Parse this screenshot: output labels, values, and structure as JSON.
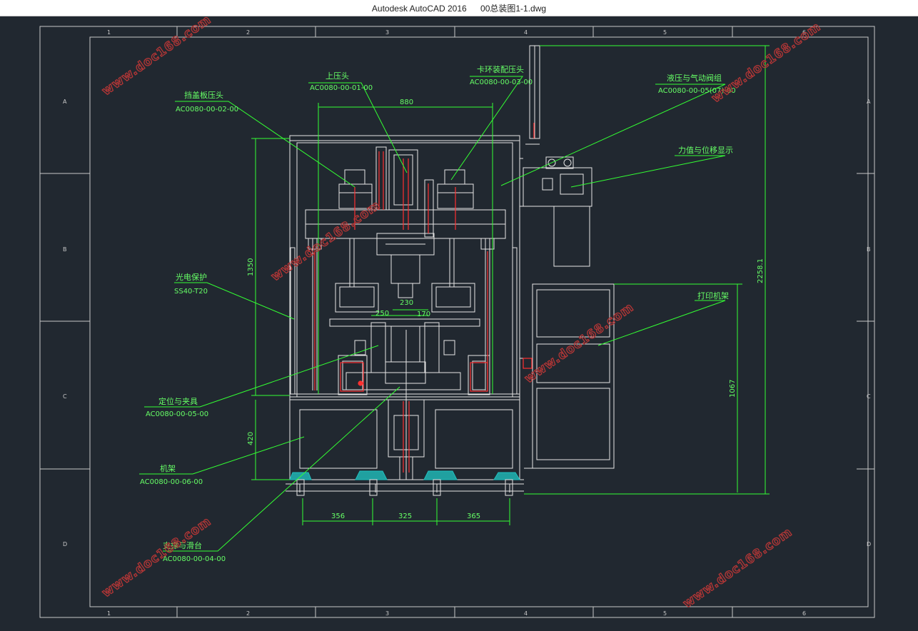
{
  "window": {
    "app": "Autodesk AutoCAD 2016",
    "file": "00总装图1-1.dwg"
  },
  "frame": {
    "columns": [
      "1",
      "2",
      "3",
      "4",
      "5",
      "6"
    ],
    "rows": [
      "A",
      "B",
      "C",
      "D"
    ]
  },
  "labels": {
    "upper_press": {
      "title": "上压头",
      "code": "AC0080-00-01-00"
    },
    "cap_press": {
      "title": "挡盖板压头",
      "code": "AC0080-00-02-00"
    },
    "ring_press": {
      "title": "卡环装配压头",
      "code": "AC0080-00-03-00"
    },
    "hydraulic": {
      "title": "液压与气动阀组",
      "code": "AC0080-00-05(07)-00"
    },
    "force_display": {
      "title": "力值与位移显示"
    },
    "photo_guard": {
      "title": "光电保护",
      "code": "SS40-T20"
    },
    "printer_rack": {
      "title": "打印机架"
    },
    "fixture": {
      "title": "定位与夹具",
      "code": "AC0080-00-05-00"
    },
    "frame_body": {
      "title": "机架",
      "code": "AC0080-00-06-00"
    },
    "support": {
      "title": "支撑与滑台",
      "code": "AC0080-00-04-00"
    }
  },
  "dimensions": {
    "top_width": "880",
    "left_height": "1350",
    "lower_height": "420",
    "total_height": "2258.1",
    "printer_height": "1067",
    "d250": "250",
    "d230": "230",
    "d170": "170",
    "foot_left": "356",
    "foot_mid": "325",
    "foot_right": "365"
  },
  "watermark": "www.doc168.com",
  "colors": {
    "background": "#212830",
    "frame_line": "#c8c8c8",
    "drawing_line": "#e6e6e6",
    "leader_green": "#33ff33",
    "text_green": "#66ff66",
    "red": "#ff3030",
    "cyan": "#20c0c0",
    "watermark": "#b33636"
  }
}
